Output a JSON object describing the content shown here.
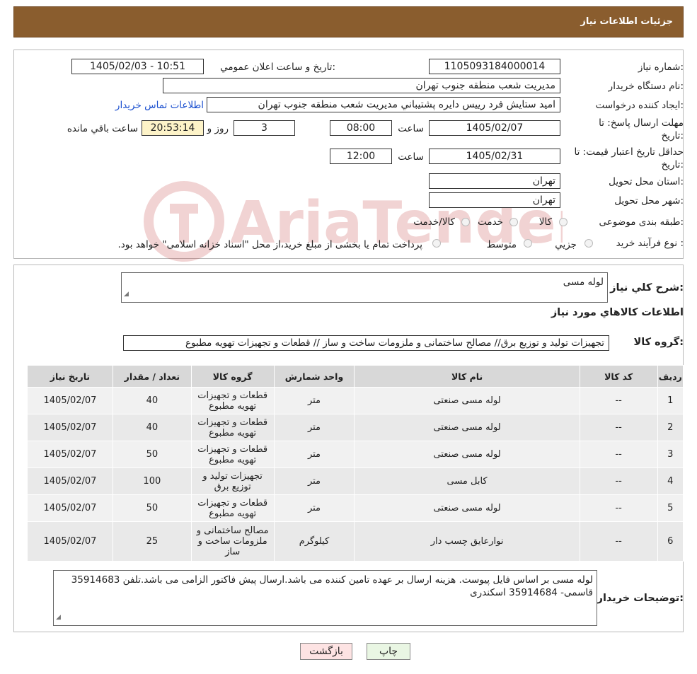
{
  "header": {
    "title": "جزئیات اطلاعات نیاز"
  },
  "form": {
    "need_number_label": "شماره نیاز:",
    "need_number": "1105093184000014",
    "announce_label": "تاریخ و ساعت اعلان عمومي:",
    "announce_value": "1405/02/03 - 10:51",
    "buyer_org_label": "نام دستگاه خریدار:",
    "buyer_org": "مديريت شعب منطقه جنوب تهران",
    "creator_label": "ایجاد کننده درخواست:",
    "creator": "امید ستایش فرد رييس دايره پشتيباني مديريت شعب منطقه جنوب تهران",
    "contact_link": "اطلاعات تماس خریدار",
    "deadline_label_1": "مهلت ارسال پاسخ: تا",
    "deadline_label_2": "تاریخ:",
    "deadline_date": "1405/02/07",
    "time_label": "ساعت",
    "deadline_time": "08:00",
    "days_value": "3",
    "days_label": "روز و",
    "remaining_value": "20:53:14",
    "remaining_label": "ساعت باقي مانده",
    "validity_label_1": "حداقل تاریخ اعتبار قیمت: تا",
    "validity_label_2": "تاریخ:",
    "validity_date": "1405/02/31",
    "validity_time": "12:00",
    "province_label": "استان محل تحویل:",
    "province": "تهران",
    "city_label": "شهر محل تحویل:",
    "city": "تهران",
    "category_label": "طبقه بندی موضوعی:",
    "category_options": [
      "کالا",
      "خدمت",
      "کالا/خدمت"
    ],
    "process_label": "نوع فرآیند خرید :",
    "process_options": [
      "جزيي",
      "متوسط"
    ],
    "process_note": "پرداخت تمام یا بخشی از مبلغ خرید،از محل \"اسناد خزانه اسلامی\" خواهد بود."
  },
  "summary": {
    "desc_label": "شرح کلي نياز:",
    "desc_value": "لوله مسی",
    "items_title": "اطلاعات کالاهاي مورد نياز",
    "group_label": "گروه کالا:",
    "group_value": "تجهیزات تولید و توزیع برق// مصالح ساختمانی و ملزومات ساخت و ساز //  قطعات و تجهیزات تهویه مطبوع"
  },
  "table": {
    "headers": [
      "رديف",
      "کد کالا",
      "نام کالا",
      "واحد شمارش",
      "گروه کالا",
      "تعداد / مقدار",
      "تاریخ نیاز"
    ],
    "rows": [
      [
        "1",
        "--",
        "لوله مسی صنعتی",
        "متر",
        "قطعات و تجهیزات تهویه مطبوع",
        "40",
        "1405/02/07"
      ],
      [
        "2",
        "--",
        "لوله مسی صنعتی",
        "متر",
        "قطعات و تجهیزات تهویه مطبوع",
        "40",
        "1405/02/07"
      ],
      [
        "3",
        "--",
        "لوله مسی صنعتی",
        "متر",
        "قطعات و تجهیزات تهویه مطبوع",
        "50",
        "1405/02/07"
      ],
      [
        "4",
        "--",
        "کابل مسی",
        "متر",
        "تجهیزات تولید و توزیع برق",
        "100",
        "1405/02/07"
      ],
      [
        "5",
        "--",
        "لوله مسی صنعتی",
        "متر",
        "قطعات و تجهیزات تهویه مطبوع",
        "50",
        "1405/02/07"
      ],
      [
        "6",
        "--",
        "نوارعایق چسب دار",
        "کیلوگرم",
        "مصالح ساختمانی و ملزومات ساخت و ساز",
        "25",
        "1405/02/07"
      ]
    ]
  },
  "notes": {
    "label": "توضیحات خریدار:",
    "value": "لوله مسی بر اساس فایل پیوست. هزینه ارسال بر عهده تامین کننده می باشد.ارسال پیش فاکتور الزامی می باشد.تلفن 35914683 قاسمی- 35914684 اسکندری"
  },
  "buttons": {
    "print": "چاپ",
    "back": "بازگشت"
  },
  "watermark": {
    "text": "AriaTender.neT",
    "color": "#c23a3a"
  }
}
